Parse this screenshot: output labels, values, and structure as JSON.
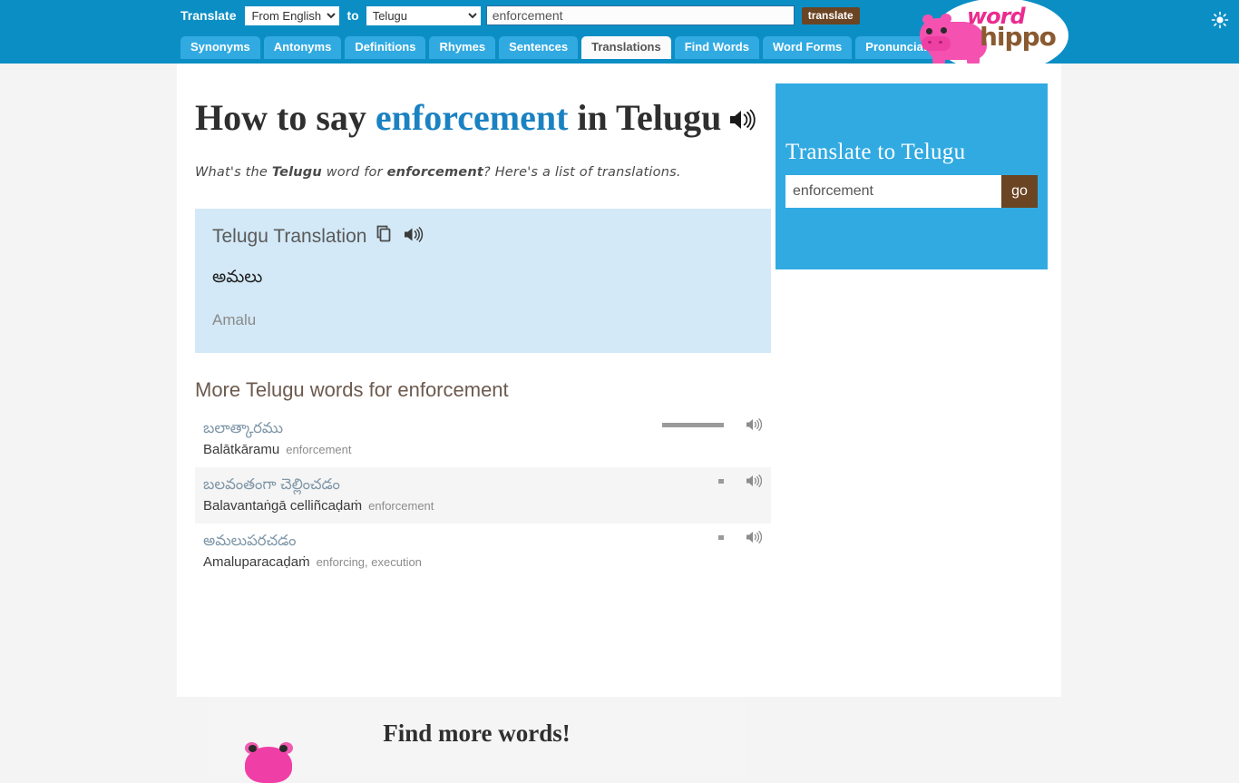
{
  "header": {
    "translate_label": "Translate",
    "from_select": {
      "value": "From English",
      "options": [
        "From English"
      ]
    },
    "to_word": "to",
    "to_select": {
      "value": "Telugu",
      "options": [
        "Telugu"
      ]
    },
    "word_input": {
      "value": "enforcement",
      "placeholder": ""
    },
    "translate_button": "translate",
    "theme_toggle_icon": "sun-icon",
    "logo": {
      "word": "word",
      "hippo": "hippo"
    },
    "tabs": [
      {
        "label": "Synonyms",
        "active": false
      },
      {
        "label": "Antonyms",
        "active": false
      },
      {
        "label": "Definitions",
        "active": false
      },
      {
        "label": "Rhymes",
        "active": false
      },
      {
        "label": "Sentences",
        "active": false
      },
      {
        "label": "Translations",
        "active": true
      },
      {
        "label": "Find Words",
        "active": false
      },
      {
        "label": "Word Forms",
        "active": false
      },
      {
        "label": "Pronunciations",
        "active": false
      }
    ]
  },
  "main": {
    "title_pre": "How to say ",
    "title_word": "enforcement",
    "title_post": " in Telugu",
    "title_speaker_icon": "speaker-icon",
    "subtitle_a": "What's the ",
    "subtitle_lang": "Telugu",
    "subtitle_b": " word for ",
    "subtitle_word": "enforcement",
    "subtitle_c": "? Here's a list of translations.",
    "translation_card": {
      "heading": "Telugu Translation",
      "copy_icon": "copy-icon",
      "speaker_icon": "speaker-icon",
      "native": "అమలు",
      "latin": "Amalu"
    },
    "more_heading": "More Telugu words for enforcement",
    "words": [
      {
        "native": "బలాత్కారము",
        "latin": "Balātkāramu",
        "definition": "enforcement",
        "meter_width": 68,
        "speaker_icon": "speaker-icon"
      },
      {
        "native": "బలవంతంగా చెల్లించడం",
        "latin": "Balavantaṅgā celliñcaḍaṁ",
        "definition": "enforcement",
        "meter_width": 6,
        "speaker_icon": "speaker-icon"
      },
      {
        "native": "అమలుపరచడం",
        "latin": "Amaluparacaḍaṁ",
        "definition": "enforcing, execution",
        "meter_width": 6,
        "speaker_icon": "speaker-icon"
      }
    ],
    "find_more_title": "Find more words!"
  },
  "sidebar": {
    "title": "Translate to Telugu",
    "input": {
      "value": "enforcement",
      "placeholder": ""
    },
    "go_button": "go"
  }
}
